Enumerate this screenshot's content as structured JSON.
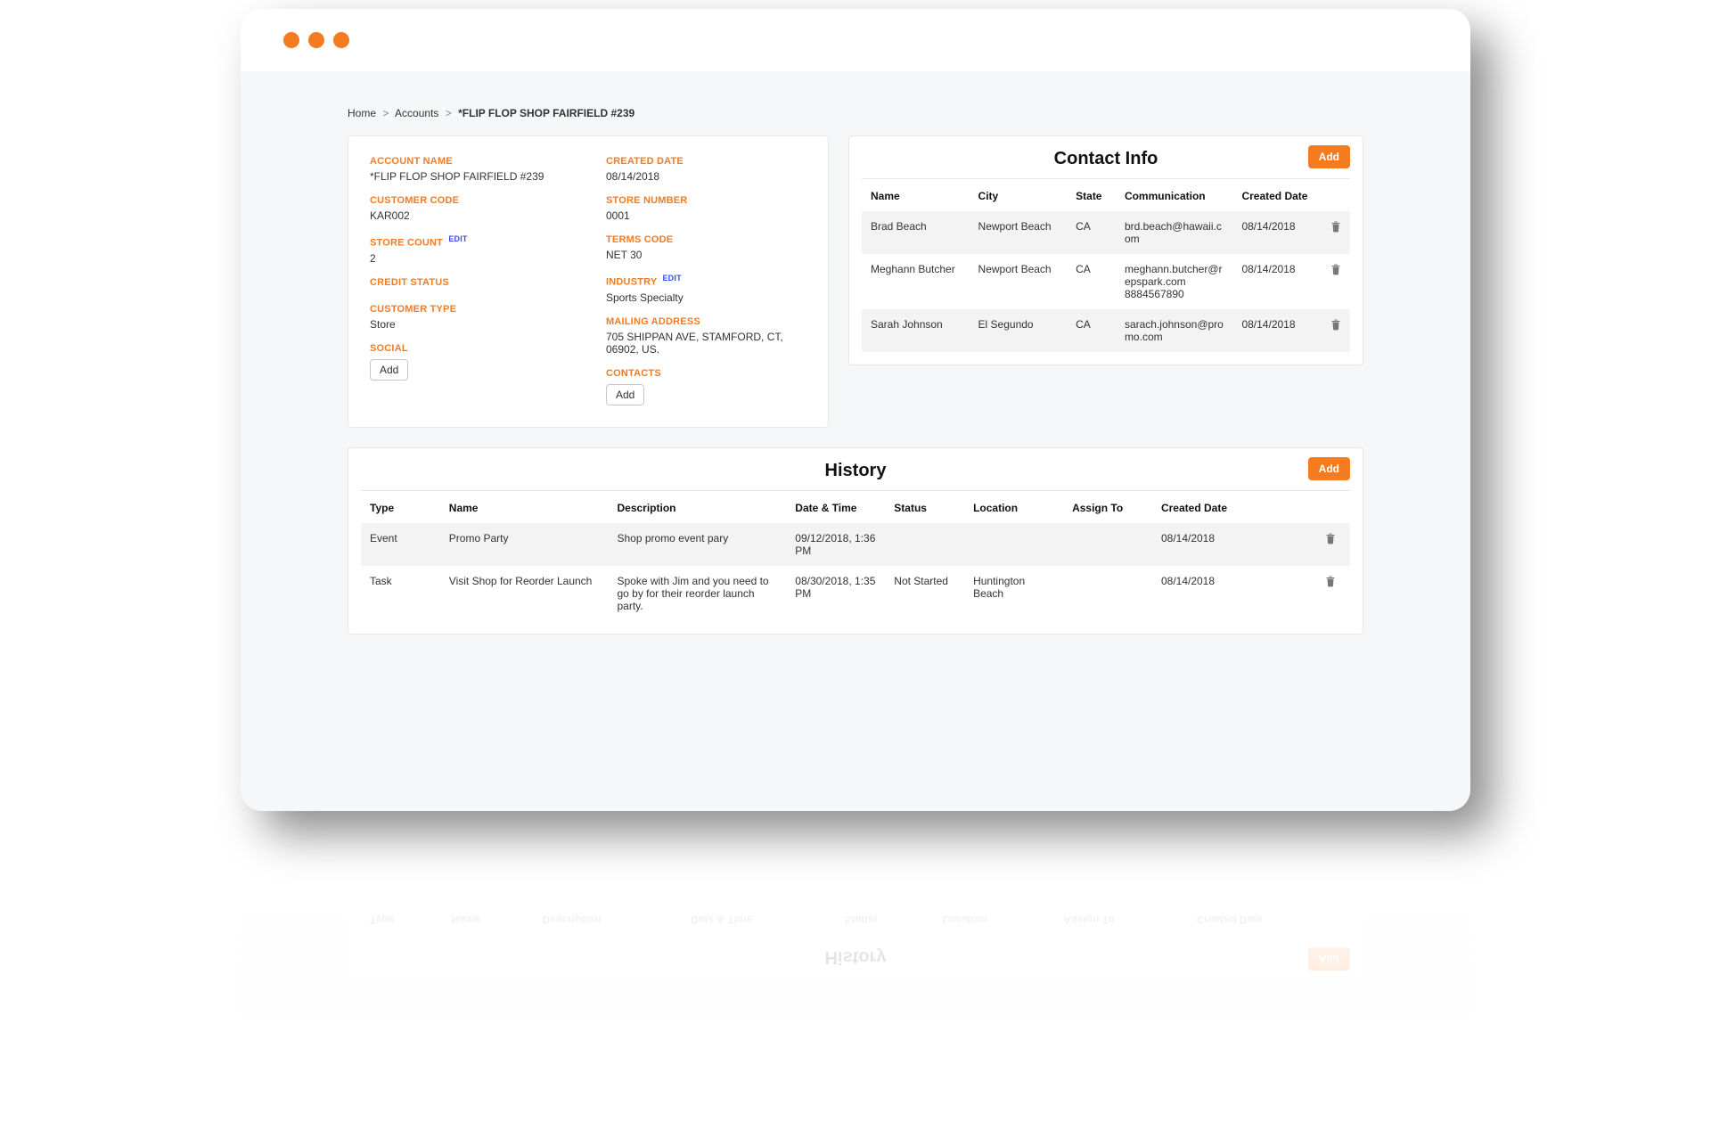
{
  "breadcrumbs": {
    "home": "Home",
    "accounts": "Accounts",
    "current": "*FLIP FLOP SHOP FAIRFIELD #239"
  },
  "details": {
    "left": {
      "account_name_label": "ACCOUNT NAME",
      "account_name": "*FLIP FLOP SHOP FAIRFIELD #239",
      "customer_code_label": "CUSTOMER CODE",
      "customer_code": "KAR002",
      "store_count_label": "STORE COUNT",
      "store_count_edit": "EDIT",
      "store_count": "2",
      "credit_status_label": "CREDIT STATUS",
      "credit_status": "",
      "customer_type_label": "CUSTOMER TYPE",
      "customer_type": "Store",
      "social_label": "SOCIAL",
      "add_label": "Add"
    },
    "right": {
      "created_date_label": "CREATED DATE",
      "created_date": "08/14/2018",
      "store_number_label": "STORE NUMBER",
      "store_number": "0001",
      "terms_code_label": "TERMS CODE",
      "terms_code": "NET 30",
      "industry_label": "INDUSTRY",
      "industry_edit": "EDIT",
      "industry": "Sports Specialty",
      "mailing_label": "MAILING ADDRESS",
      "mailing": "705 SHIPPAN AVE, STAMFORD, CT, 06902, US.",
      "contacts_label": "CONTACTS",
      "add_label": "Add"
    }
  },
  "contacts": {
    "title": "Contact Info",
    "add_label": "Add",
    "headers": {
      "name": "Name",
      "city": "City",
      "state": "State",
      "comm": "Communication",
      "created": "Created Date"
    },
    "rows": [
      {
        "name": "Brad Beach",
        "city": "Newport Beach",
        "state": "CA",
        "comm": "brd.beach@hawaii.com",
        "created": "08/14/2018"
      },
      {
        "name": "Meghann Butcher",
        "city": "Newport Beach",
        "state": "CA",
        "comm": "meghann.butcher@repspark.com 8884567890",
        "created": "08/14/2018"
      },
      {
        "name": "Sarah Johnson",
        "city": "El Segundo",
        "state": "CA",
        "comm": "sarach.johnson@promo.com",
        "created": "08/14/2018"
      }
    ]
  },
  "history": {
    "title": "History",
    "add_label": "Add",
    "headers": {
      "type": "Type",
      "name": "Name",
      "desc": "Description",
      "dt": "Date & Time",
      "status": "Status",
      "loc": "Location",
      "assign": "Assign To",
      "created": "Created Date"
    },
    "rows": [
      {
        "type": "Event",
        "name": "Promo Party",
        "desc": "Shop promo event pary",
        "dt": "09/12/2018, 1:36 PM",
        "status": "",
        "loc": "",
        "assign": "",
        "created": "08/14/2018"
      },
      {
        "type": "Task",
        "name": "Visit Shop for Reorder Launch",
        "desc": "Spoke with Jim and you need to go by for their reorder launch party.",
        "dt": "08/30/2018, 1:35 PM",
        "status": "Not Started",
        "loc": "Huntington Beach",
        "assign": "",
        "created": "08/14/2018"
      }
    ]
  }
}
